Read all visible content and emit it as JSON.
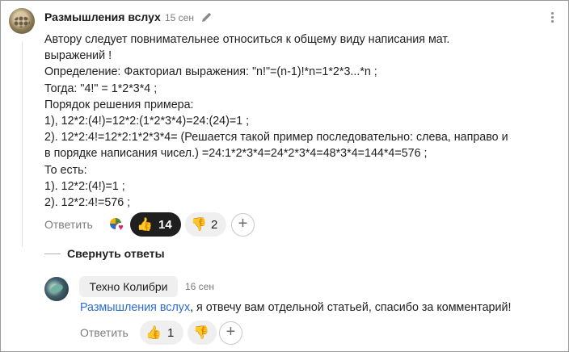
{
  "comment": {
    "author": "Размышления вслух",
    "date": "15 сен",
    "lines": [
      "Автору следует повнимательнее относиться к общему виду написания мат.",
      "выражений !",
      "Определение: Факториал выражения: \"n!\"=(n-1)!*n=1*2*3...*n ;",
      "Тогда: \"4!\" = 1*2*3*4 ;",
      "Порядок решения примера:",
      "1), 12*2:(4!)=12*2:(1*2*3*4)=24:(24)=1 ;",
      "2). 12*2:4!=12*2:1*2*3*4= (Решается такой пример последовательно: слева, направо и",
      "в порядке написания чисел.) =24:1*2*3*4=24*2*3*4=48*3*4=144*4=576 ;",
      "То есть:",
      "1). 12*2:(4!)=1 ;",
      "2). 12*2:4!=576 ;"
    ],
    "reply_label": "Ответить",
    "likes": "14",
    "dislikes": "2",
    "like_emoji": "👍",
    "dislike_emoji": "👎",
    "add_label": "+",
    "mini_reaction_icon": "heart-icon"
  },
  "collapse_label": "Свернуть ответы",
  "reply": {
    "author": "Техно Колибри",
    "date": "16 сен",
    "mention": "Размышления вслух",
    "text": ", я отвечу вам отдельной статьей, спасибо за комментарий!",
    "reply_label": "Ответить",
    "likes": "1",
    "like_emoji": "👍",
    "dislike_emoji": "👎",
    "add_label": "+"
  },
  "colors": {
    "mention": "#2b6cd8",
    "dark_pill": "#1f1f1f",
    "pill": "#efefef"
  }
}
